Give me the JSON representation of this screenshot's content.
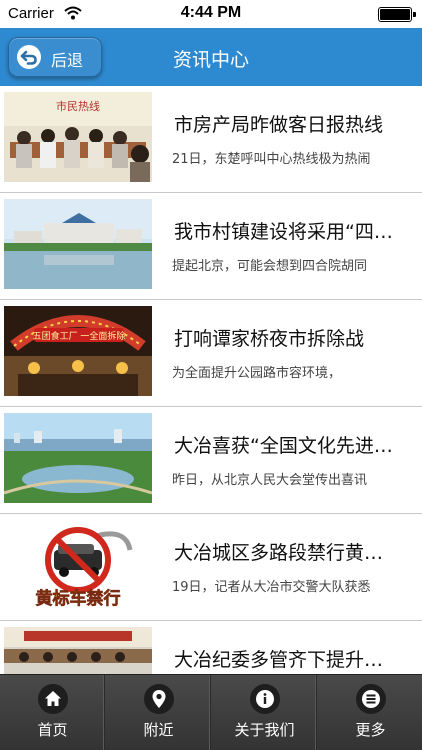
{
  "status_bar": {
    "carrier": "Carrier",
    "time": "4:44 PM"
  },
  "nav": {
    "back_label": "后退",
    "title": "资讯中心"
  },
  "news": [
    {
      "title": "市房产局昨做客日报热线",
      "summary": "21日，东楚呼叫中心热线极为热闹",
      "thumb": "photo-meeting",
      "thumb_text": "市民热线"
    },
    {
      "title": "我市村镇建设将采用“四合院”",
      "summary": "提起北京，可能会想到四合院胡同",
      "thumb": "photo-lake-building"
    },
    {
      "title": "打响谭家桥夜市拆除战",
      "summary": "为全面提升公园路市容环境，",
      "thumb": "photo-night-market",
      "thumb_text": "五团食工厂 一全面拆除"
    },
    {
      "title": "大冶喜获“全国文化先进县”",
      "summary": "昨日，从北京人民大会堂传出喜讯",
      "thumb": "photo-city-aerial"
    },
    {
      "title": "大冶城区多路段禁行黄标车",
      "summary": "19日，记者从大冶市交警大队获悉",
      "thumb": "yellow-label-car-ban-icon",
      "thumb_text": "黄标车禁行"
    },
    {
      "title": "大冶纪委多管齐下提升效能",
      "summary": "",
      "thumb": "photo-conference"
    }
  ],
  "tabbar": [
    {
      "label": "首页",
      "icon": "home-icon"
    },
    {
      "label": "附近",
      "icon": "location-pin-icon"
    },
    {
      "label": "关于我们",
      "icon": "info-icon"
    },
    {
      "label": "更多",
      "icon": "more-list-icon"
    }
  ],
  "colors": {
    "nav_blue": "#2e8ad0",
    "tabbar_dark": "#3a3a3a"
  }
}
